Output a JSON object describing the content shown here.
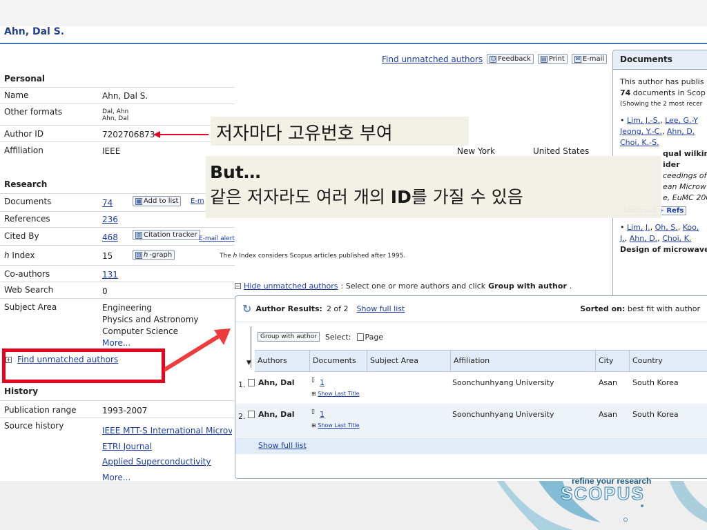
{
  "page_title": "Ahn, Dal S.",
  "top_links": {
    "find_unmatched": "Find unmatched authors",
    "feedback": "Feedback",
    "print": "Print",
    "email": "E-mail"
  },
  "personal": {
    "header": "Personal",
    "name_label": "Name",
    "name_value": "Ahn, Dal S.",
    "other_formats_label": "Other formats",
    "other_formats_1": "Dal, Ahn",
    "other_formats_2": "Ahn, Dal",
    "author_id_label": "Author ID",
    "author_id_value": "7202706873",
    "affiliation_label": "Affiliation",
    "affiliation_value": "IEEE",
    "affiliation_city": "New York",
    "affiliation_country": "United States"
  },
  "research": {
    "header": "Research",
    "documents_label": "Documents",
    "documents_value": "74",
    "add_to_list": "Add to list",
    "documents_alert": "E-m",
    "references_label": "References",
    "references_value": "236",
    "cited_by_label": "Cited By",
    "cited_by_value": "468",
    "citation_tracker": "Citation tracker",
    "email_alert": "E-mail alert",
    "h_index_label_italic": "h",
    "h_index_label_rest": " Index",
    "h_index_value": "15",
    "h_graph_prefix": "h",
    "h_graph_rest": "-graph",
    "h_note_pre": "The ",
    "h_note_italic": "h",
    "h_note_post": " Index considers Scopus articles published after 1995.",
    "coauthors_label": "Co-authors",
    "coauthors_value": "131",
    "web_search_label": "Web Search",
    "web_search_value": "0",
    "subject_label": "Subject Area",
    "subject_1": "Engineering",
    "subject_2": "Physics and Astronomy",
    "subject_3": "Computer Science",
    "subject_more": "More..."
  },
  "find_unmatched_expand": "Find unmatched authors",
  "history": {
    "header": "History",
    "pub_range_label": "Publication range",
    "pub_range_value": "1993-2007",
    "source_history_label": "Source history",
    "source_1": "IEEE MTT-S International Microv",
    "source_2": "ETRI Journal",
    "source_3": "Applied Superconductivity",
    "source_more": "More..."
  },
  "korean": {
    "line1": "저자마다 고유번호 부여",
    "line2": "But…",
    "line3_pre": "같은 저자라도 여러 개의 ",
    "line3_bold": "ID",
    "line3_post": "를 가질 수 있음"
  },
  "documents_panel": {
    "title": "Documents",
    "line1": "This author has publis",
    "line2_bold": "74",
    "line2_rest": " documents in Scop",
    "line3": "(Showing the 2 most recer",
    "item1_authors_1": "Lim, J.-S.",
    "item1_authors_2": "Lee, G.-Y",
    "item1_authors_3": "Jeong, Y.-C.",
    "item1_authors_4": "Ahn, D.",
    "item1_authors_5": "Choi, K.-S.",
    "item1_title_1": "qual wilkin",
    "item1_title_2": "ider",
    "item1_src_1": "ceedings of",
    "item1_src_2": "ean Microw",
    "item1_src_3": "e, EuMC 200",
    "abstract_refs": "Abstract + Refs",
    "item2_authors_1": "Lim, J.",
    "item2_authors_2": "Oh, S.",
    "item2_authors_3": "Koo,",
    "item2_authors_4": "J.",
    "item2_authors_5": "Ahn, D.",
    "item2_authors_6": "Choi, K.",
    "item2_title": "Design of microwave"
  },
  "unmatched": {
    "hide_link": "Hide unmatched authors",
    "instruction_pre": ": Select one or more authors and click ",
    "instruction_bold": "Group with author",
    "instruction_post": ".",
    "results_label": "Author Results:",
    "results_count": "2 of 2",
    "show_full_list": "Show full list",
    "sorted_label": "Sorted on:",
    "sorted_value": "best fit with author",
    "group_btn": "Group with author",
    "select_label": "Select:",
    "select_page": "Page",
    "columns": [
      "Authors",
      "Documents",
      "Subject Area",
      "Affiliation",
      "City",
      "Country"
    ],
    "rows": [
      {
        "num": "1.",
        "author": "Ahn, Dal",
        "docs": "1",
        "show_last": "Show Last Title",
        "subject": "",
        "affiliation": "Soonchunhyang University",
        "city": "Asan",
        "country": "South Korea"
      },
      {
        "num": "2.",
        "author": "Ahn, Dal",
        "docs": "1",
        "show_last": "Show Last Title",
        "subject": "",
        "affiliation": "Soonchunhyang University",
        "city": "Asan",
        "country": "South Korea"
      }
    ],
    "footer_link": "Show full list"
  },
  "logo": {
    "tagline": "refine your research",
    "brand": "SCOPUS"
  },
  "colors": {
    "title": "#24408e",
    "link": "#1a3ca6",
    "highlight": "#e8001c",
    "rule": "#3b6fb6"
  }
}
